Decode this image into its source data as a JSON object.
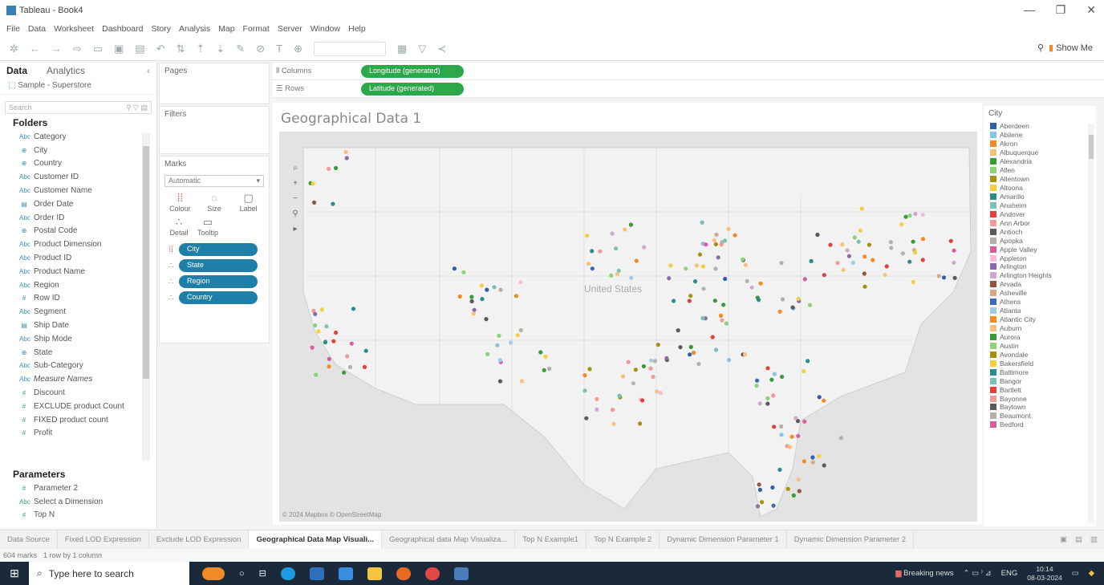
{
  "window": {
    "title": "Tableau - Book4"
  },
  "menu": [
    "File",
    "Data",
    "Worksheet",
    "Dashboard",
    "Story",
    "Analysis",
    "Map",
    "Format",
    "Server",
    "Window",
    "Help"
  ],
  "toolbar": {
    "show_me": "Show Me"
  },
  "data_pane": {
    "tab_data": "Data",
    "tab_analytics": "Analytics",
    "datasource": "Sample - Superstore",
    "search_placeholder": "Search",
    "folders_heading": "Folders",
    "fields": [
      {
        "name": "Category",
        "kind": "dim",
        "icon": "Abc"
      },
      {
        "name": "City",
        "kind": "dim",
        "icon": "globe"
      },
      {
        "name": "Country",
        "kind": "dim",
        "icon": "globe"
      },
      {
        "name": "Customer ID",
        "kind": "dim",
        "icon": "Abc"
      },
      {
        "name": "Customer Name",
        "kind": "dim",
        "icon": "Abc"
      },
      {
        "name": "Order Date",
        "kind": "dim",
        "icon": "date"
      },
      {
        "name": "Order ID",
        "kind": "dim",
        "icon": "Abc"
      },
      {
        "name": "Postal Code",
        "kind": "dim",
        "icon": "globe"
      },
      {
        "name": "Product Dimension",
        "kind": "dim",
        "icon": "Abc"
      },
      {
        "name": "Product ID",
        "kind": "dim",
        "icon": "Abc"
      },
      {
        "name": "Product Name",
        "kind": "dim",
        "icon": "Abc"
      },
      {
        "name": "Region",
        "kind": "dim",
        "icon": "Abc"
      },
      {
        "name": "Row ID",
        "kind": "dim",
        "icon": "#"
      },
      {
        "name": "Segment",
        "kind": "dim",
        "icon": "Abc"
      },
      {
        "name": "Ship Date",
        "kind": "dim",
        "icon": "date"
      },
      {
        "name": "Ship Mode",
        "kind": "dim",
        "icon": "Abc"
      },
      {
        "name": "State",
        "kind": "dim",
        "icon": "globe"
      },
      {
        "name": "Sub-Category",
        "kind": "dim",
        "icon": "Abc"
      },
      {
        "name": "Measure Names",
        "kind": "dim",
        "icon": "Abc",
        "italic": true
      },
      {
        "name": "Discount",
        "kind": "meas",
        "icon": "#"
      },
      {
        "name": "EXCLUDE product Count",
        "kind": "meas",
        "icon": "#"
      },
      {
        "name": "FIXED product count",
        "kind": "meas",
        "icon": "#"
      },
      {
        "name": "Profit",
        "kind": "meas",
        "icon": "#"
      }
    ],
    "parameters_heading": "Parameters",
    "parameters": [
      {
        "name": "Parameter 2",
        "icon": "#"
      },
      {
        "name": "Select a Dimension",
        "icon": "Abc"
      },
      {
        "name": "Top N",
        "icon": "#"
      }
    ]
  },
  "cards": {
    "pages": "Pages",
    "filters": "Filters",
    "marks": "Marks",
    "mark_type": "Automatic",
    "mark_buttons": [
      "Colour",
      "Size",
      "Label",
      "Detail",
      "Tooltip"
    ],
    "mark_pills": [
      {
        "label": "City",
        "icon": "color"
      },
      {
        "label": "State",
        "icon": "detail"
      },
      {
        "label": "Region",
        "icon": "detail"
      },
      {
        "label": "Country",
        "icon": "detail"
      }
    ]
  },
  "shelves": {
    "columns_label": "Columns",
    "columns_pill": "Longitude (generated)",
    "rows_label": "Rows",
    "rows_pill": "Latitude (generated)"
  },
  "viz": {
    "title": "Geographical Data 1",
    "attribution": "© 2024 Mapbox © OpenStreetMap",
    "map_labels": [
      "United States"
    ]
  },
  "legend": {
    "title": "City",
    "items": [
      {
        "name": "Aberdeen",
        "color": "#2f5fa8"
      },
      {
        "name": "Abilene",
        "color": "#8cc1e6"
      },
      {
        "name": "Akron",
        "color": "#f28a26"
      },
      {
        "name": "Albuquerque",
        "color": "#f8c07a"
      },
      {
        "name": "Alexandria",
        "color": "#3a9a3a"
      },
      {
        "name": "Allen",
        "color": "#8fd07c"
      },
      {
        "name": "Allentown",
        "color": "#a6900e"
      },
      {
        "name": "Altoona",
        "color": "#f0d040"
      },
      {
        "name": "Amarillo",
        "color": "#2c8c8c"
      },
      {
        "name": "Anaheim",
        "color": "#7ac0b8"
      },
      {
        "name": "Andover",
        "color": "#e0423c"
      },
      {
        "name": "Ann Arbor",
        "color": "#f49a98"
      },
      {
        "name": "Antioch",
        "color": "#5a5a5a"
      },
      {
        "name": "Apopka",
        "color": "#b5b0aa"
      },
      {
        "name": "Apple Valley",
        "color": "#d55fa0"
      },
      {
        "name": "Appleton",
        "color": "#f5bdd8"
      },
      {
        "name": "Arlington",
        "color": "#8f6aa8"
      },
      {
        "name": "Arlington Heights",
        "color": "#cfa8cf"
      },
      {
        "name": "Arvada",
        "color": "#8c5a3a"
      },
      {
        "name": "Asheville",
        "color": "#d5a98a"
      },
      {
        "name": "Athens",
        "color": "#3b6ab8"
      },
      {
        "name": "Atlanta",
        "color": "#a3cbe8"
      },
      {
        "name": "Atlantic City",
        "color": "#f28a26"
      },
      {
        "name": "Auburn",
        "color": "#f8c07a"
      },
      {
        "name": "Aurora",
        "color": "#3a9a3a"
      },
      {
        "name": "Austin",
        "color": "#8fd07c"
      },
      {
        "name": "Avondale",
        "color": "#a6900e"
      },
      {
        "name": "Bakersfield",
        "color": "#f0d040"
      },
      {
        "name": "Baltimore",
        "color": "#2c8c8c"
      },
      {
        "name": "Bangor",
        "color": "#7ac0b8"
      },
      {
        "name": "Bartlett",
        "color": "#e0423c"
      },
      {
        "name": "Bayonne",
        "color": "#f49a98"
      },
      {
        "name": "Baytown",
        "color": "#5a5a5a"
      },
      {
        "name": "Beaumont",
        "color": "#b5b0aa"
      },
      {
        "name": "Bedford",
        "color": "#d55fa0"
      }
    ]
  },
  "sheet_tabs": [
    {
      "label": "Data Source",
      "active": false
    },
    {
      "label": "Fixed LOD Expression",
      "active": false
    },
    {
      "label": "Exclude LOD Expression",
      "active": false
    },
    {
      "label": "Geographical Data Map Visuali...",
      "active": true
    },
    {
      "label": "Geographical data Map Visualiza...",
      "active": false
    },
    {
      "label": "Top N Example1",
      "active": false
    },
    {
      "label": "Top N Example 2",
      "active": false
    },
    {
      "label": "Dynamic Dimension Parameter 1",
      "active": false
    },
    {
      "label": "Dynamic Dimension Parameter 2",
      "active": false
    }
  ],
  "status": {
    "marks": "604 marks",
    "rows": "1 row by 1 column"
  },
  "taskbar": {
    "search_placeholder": "Type here to search",
    "news": "Breaking news",
    "lang": "ENG",
    "time": "10:14",
    "date": "08-03-2024"
  }
}
